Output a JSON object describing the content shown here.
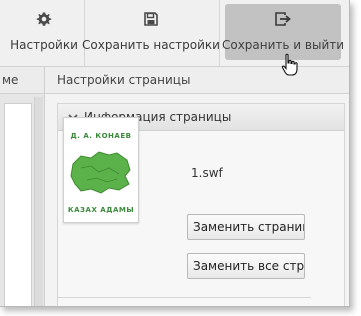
{
  "toolbar": {
    "settings": {
      "label": "Настройки",
      "icon": "gear-icon"
    },
    "save_settings": {
      "label": "Сохранить настройки",
      "icon": "floppy-disk-icon"
    },
    "save_and_exit": {
      "label": "Сохранить и выйти",
      "icon": "exit-icon"
    }
  },
  "left_panel": {
    "header_fragment": "ме"
  },
  "page_settings": {
    "header": "Настройки страницы",
    "section_title": "Информация страницы",
    "thumbnail": {
      "author_text": "Д. А. КОНАЕВ",
      "bottom_text": "КАЗАХ АДАМЫ"
    },
    "file_name": "1.swf",
    "replace_button": "Заменить страницу",
    "replace_all_button": "Заменить все стран"
  },
  "colors": {
    "toolbar_bg": "#f0f0f0",
    "active_button_bg": "#c2c2c2",
    "thumbnail_text": "#3a8a3a",
    "map_green": "#5bb24a"
  }
}
